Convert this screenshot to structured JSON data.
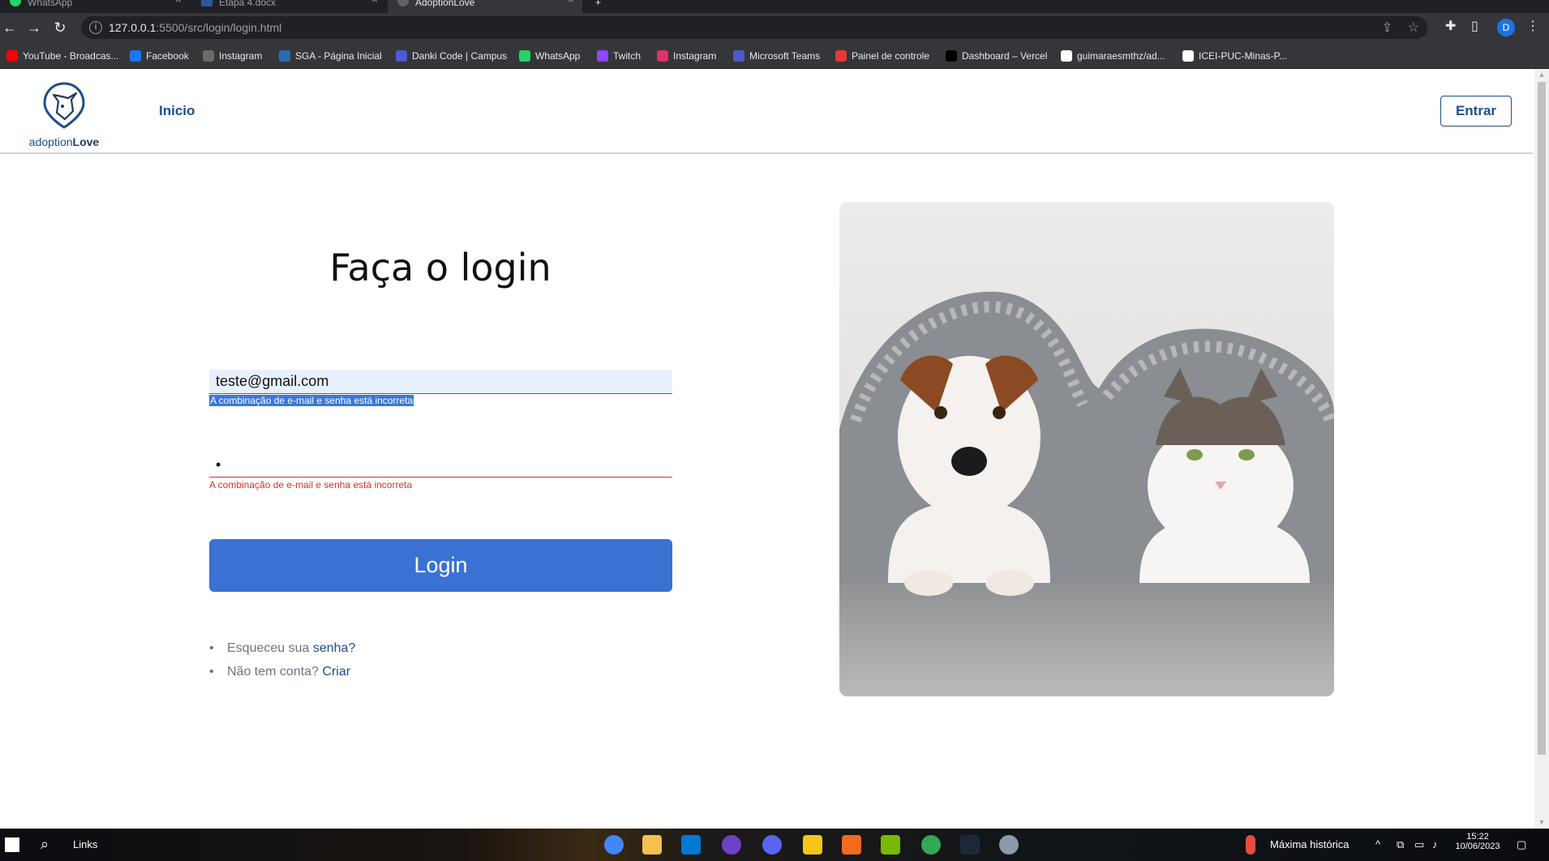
{
  "browser": {
    "tabs": [
      {
        "label": "WhatsApp",
        "active": false
      },
      {
        "label": "Etapa 4.docx",
        "active": false
      },
      {
        "label": "AdoptionLove",
        "active": true
      }
    ],
    "url_host": "127.0.0.1",
    "url_rest": ":5500/src/login/login.html",
    "profile_initial": "D",
    "bookmarks": [
      {
        "label": "YouTube - Broadcas...",
        "icon": "youtube-icon",
        "color": "#ff0000"
      },
      {
        "label": "Facebook",
        "icon": "facebook-icon",
        "color": "#1877f2"
      },
      {
        "label": "Instagram",
        "icon": "instagram-icon",
        "color": "#6b6b6b"
      },
      {
        "label": "SGA - Página Inicial",
        "icon": "sga-icon",
        "color": "#2b6cb0"
      },
      {
        "label": "Danki Code | Campus",
        "icon": "code-icon",
        "color": "#4a5ad8"
      },
      {
        "label": "WhatsApp",
        "icon": "whatsapp-icon",
        "color": "#25d366"
      },
      {
        "label": "Twitch",
        "icon": "twitch-icon",
        "color": "#9146ff"
      },
      {
        "label": "Instagram",
        "icon": "instagram-icon",
        "color": "#e1306c"
      },
      {
        "label": "Microsoft Teams",
        "icon": "teams-icon",
        "color": "#5059c9"
      },
      {
        "label": "Painel de controle",
        "icon": "control-panel-icon",
        "color": "#e53935"
      },
      {
        "label": "Dashboard – Vercel",
        "icon": "vercel-icon",
        "color": "#000000"
      },
      {
        "label": "guimaraesmthz/ad...",
        "icon": "github-icon",
        "color": "#ffffff"
      },
      {
        "label": "ICEI-PUC-Minas-P...",
        "icon": "github-icon",
        "color": "#ffffff"
      }
    ]
  },
  "site": {
    "logo_prefix": "adoption",
    "logo_suffix": "Love",
    "nav_inicio": "Inicio",
    "entrar_label": "Entrar"
  },
  "login": {
    "title": "Faça o login",
    "email_value": "teste@gmail.com",
    "email_error": "A combinação de e-mail e senha está incorreta",
    "password_value": "•",
    "password_error": "A combinação de e-mail e senha está incorreta",
    "button_label": "Login",
    "forgot_text": "Esqueceu sua ",
    "forgot_link": "senha?",
    "no_account_text": "Não tem conta? ",
    "no_account_link": "Criar"
  },
  "taskbar": {
    "search_label": "Links",
    "weather_label": "Máxima histórica",
    "time": "15:22",
    "date": "10/06/2023"
  },
  "colors": {
    "brand": "#1e4d8c",
    "login_button": "#3a72d3",
    "error": "#d93025"
  }
}
